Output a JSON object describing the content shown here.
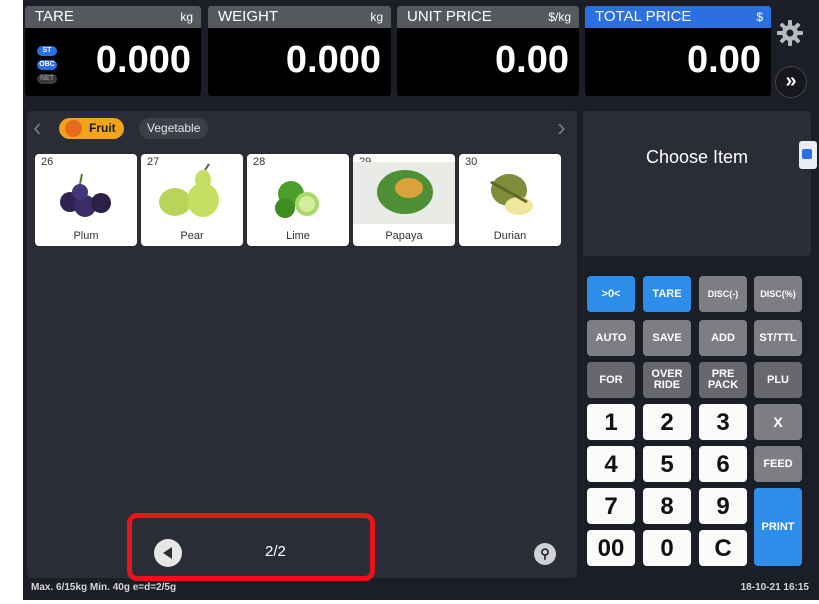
{
  "displays": {
    "tare": {
      "label": "TARE",
      "unit": "kg",
      "value": "0.000"
    },
    "weight": {
      "label": "WEIGHT",
      "unit": "kg",
      "value": "0.000"
    },
    "unit_price": {
      "label": "UNIT PRICE",
      "unit": "$/kg",
      "value": "0.00"
    },
    "total_price": {
      "label": "TOTAL PRICE",
      "unit": "$",
      "value": "0.00"
    }
  },
  "indicators": [
    "ST",
    "OBC",
    "NET"
  ],
  "more_button": "»",
  "categories": {
    "fruit": "Fruit",
    "vegetable": "Vegetable"
  },
  "items": [
    {
      "num": "26",
      "name": "Plum"
    },
    {
      "num": "27",
      "name": "Pear"
    },
    {
      "num": "28",
      "name": "Lime"
    },
    {
      "num": "29",
      "name": "Papaya"
    },
    {
      "num": "30",
      "name": "Durian"
    }
  ],
  "pager": {
    "text": "2/2"
  },
  "choose_item": "Choose Item",
  "keypad": {
    "zero": ">0<",
    "tare": "TARE",
    "disc_minus": "DISC(-)",
    "disc_pct": "DISC(%)",
    "auto": "AUTO",
    "save": "SAVE",
    "add": "ADD",
    "st_ttl": "ST/TTL",
    "for": "FOR",
    "override": "OVER RIDE",
    "prepack": "PRE PACK",
    "plu": "PLU",
    "k1": "1",
    "k2": "2",
    "k3": "3",
    "x": "X",
    "k4": "4",
    "k5": "5",
    "k6": "6",
    "feed": "FEED",
    "k7": "7",
    "k8": "8",
    "k9": "9",
    "print": "PRINT",
    "k00": "00",
    "k0": "0",
    "kc": "C"
  },
  "status": {
    "left": "Max. 6/15kg  Min. 40g  e=d=2/5g",
    "datetime": "18-10-21 16:15"
  }
}
